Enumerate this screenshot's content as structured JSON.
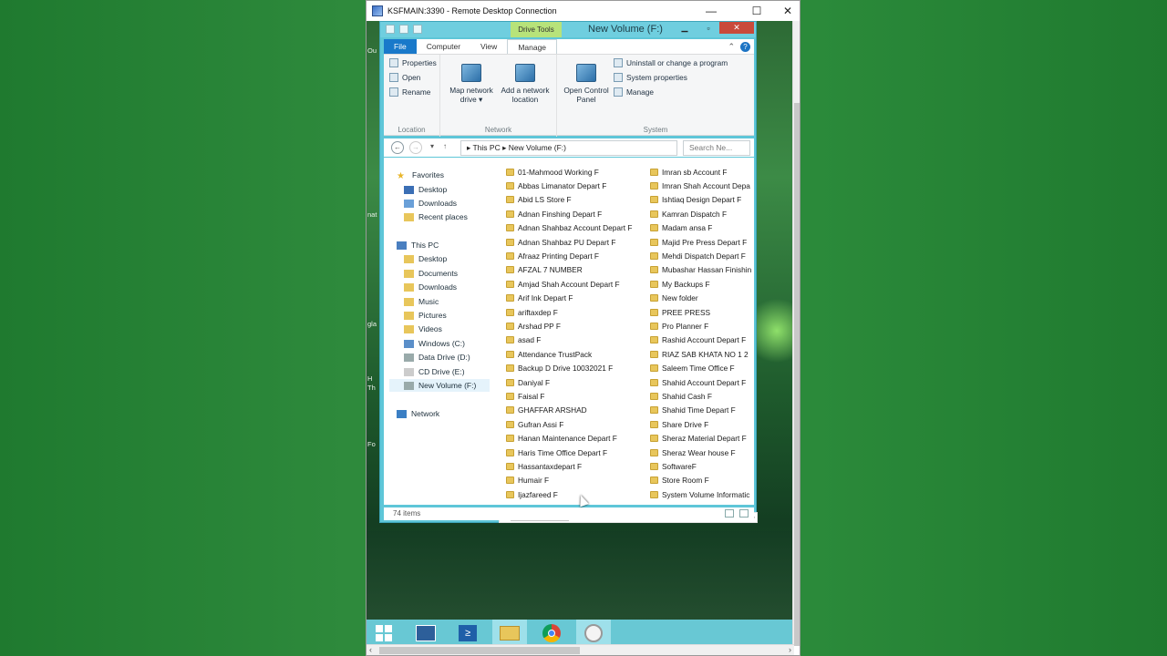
{
  "rdc": {
    "title": "KSFMAIN:3390 - Remote Desktop Connection",
    "minimize": "—",
    "maximize": "☐",
    "close": "✕"
  },
  "edge_labels": [
    "Ou",
    "nat",
    "gla",
    "H",
    "Th",
    "Fo"
  ],
  "explorer": {
    "context_tab_group": "Drive Tools",
    "window_title": "New Volume (F:)",
    "tabs": [
      "File",
      "Computer",
      "View",
      "Manage"
    ],
    "ribbon": {
      "location": {
        "items": [
          "Properties",
          "Open",
          "Rename"
        ],
        "group_name": "Location"
      },
      "network": {
        "map_network_drive": "Map network drive ▾",
        "add_network_location": "Add a network location",
        "group_name": "Network"
      },
      "system": {
        "open_control_panel": "Open Control Panel",
        "items": [
          "Uninstall or change a program",
          "System properties",
          "Manage"
        ],
        "group_name": "System"
      }
    },
    "address": {
      "path": "▸  This PC  ▸  New Volume (F:)",
      "search_placeholder": "Search Ne..."
    },
    "nav": {
      "favorites": "Favorites",
      "favorites_items": [
        "Desktop",
        "Downloads",
        "Recent places"
      ],
      "this_pc": "This PC",
      "this_pc_items": [
        "Desktop",
        "Documents",
        "Downloads",
        "Music",
        "Pictures",
        "Videos",
        "Windows (C:)",
        "Data Drive (D:)",
        "CD Drive (E:)",
        "New Volume (F:)"
      ],
      "network": "Network"
    },
    "files_col1": [
      "01-Mahmood Working F",
      "Abbas Limanator Depart F",
      "Abid LS Store F",
      "Adnan Finshing Depart F",
      "Adnan Shahbaz Account Depart F",
      "Adnan Shahbaz PU Depart F",
      "Afraaz Printing  Depart F",
      "AFZAL 7 NUMBER",
      "Amjad Shah Account Depart F",
      "Arif Ink Depart F",
      "ariftaxdep F",
      "Arshad PP F",
      "asad F",
      "Attendance TrustPack",
      "Backup D Drive 10032021 F",
      "Daniyal F",
      "Faisal F",
      "GHAFFAR ARSHAD",
      "Gufran Assi F",
      "Hanan Maintenance Depart F",
      "Haris Time Office Depart F",
      "Hassantaxdepart F",
      "Humair F",
      "Ijazfareed F"
    ],
    "files_col2": [
      "Imran sb Account F",
      "Imran Shah Account Depa",
      "Ishtiaq Design Depart F",
      "Kamran Dispatch F",
      "Madam ansa F",
      "Majid Pre Press Depart F",
      "Mehdi Dispatch Depart F",
      "Mubashar Hassan Finishin",
      "My Backups F",
      "New folder",
      "PREE PRESS",
      "Pro Planner F",
      "Rashid Account Depart F",
      "RIAZ SAB KHATA NO 1 2",
      "Saleem Time Office F",
      "Shahid Account Depart F",
      "Shahid Cash F",
      "Shahid Time Depart F",
      "Share Drive F",
      "Sheraz Material Depart F",
      "Sheraz Wear house F",
      "SoftwareF",
      "Store Room F",
      "System Volume Informatic"
    ],
    "status": "74 items"
  },
  "colors": {
    "taskbar": "#68c8d4",
    "explorer_frame": "#5ec6d8",
    "drive_tools": "#b7e37a",
    "file_tab": "#1979ca",
    "close": "#c94a3b"
  }
}
